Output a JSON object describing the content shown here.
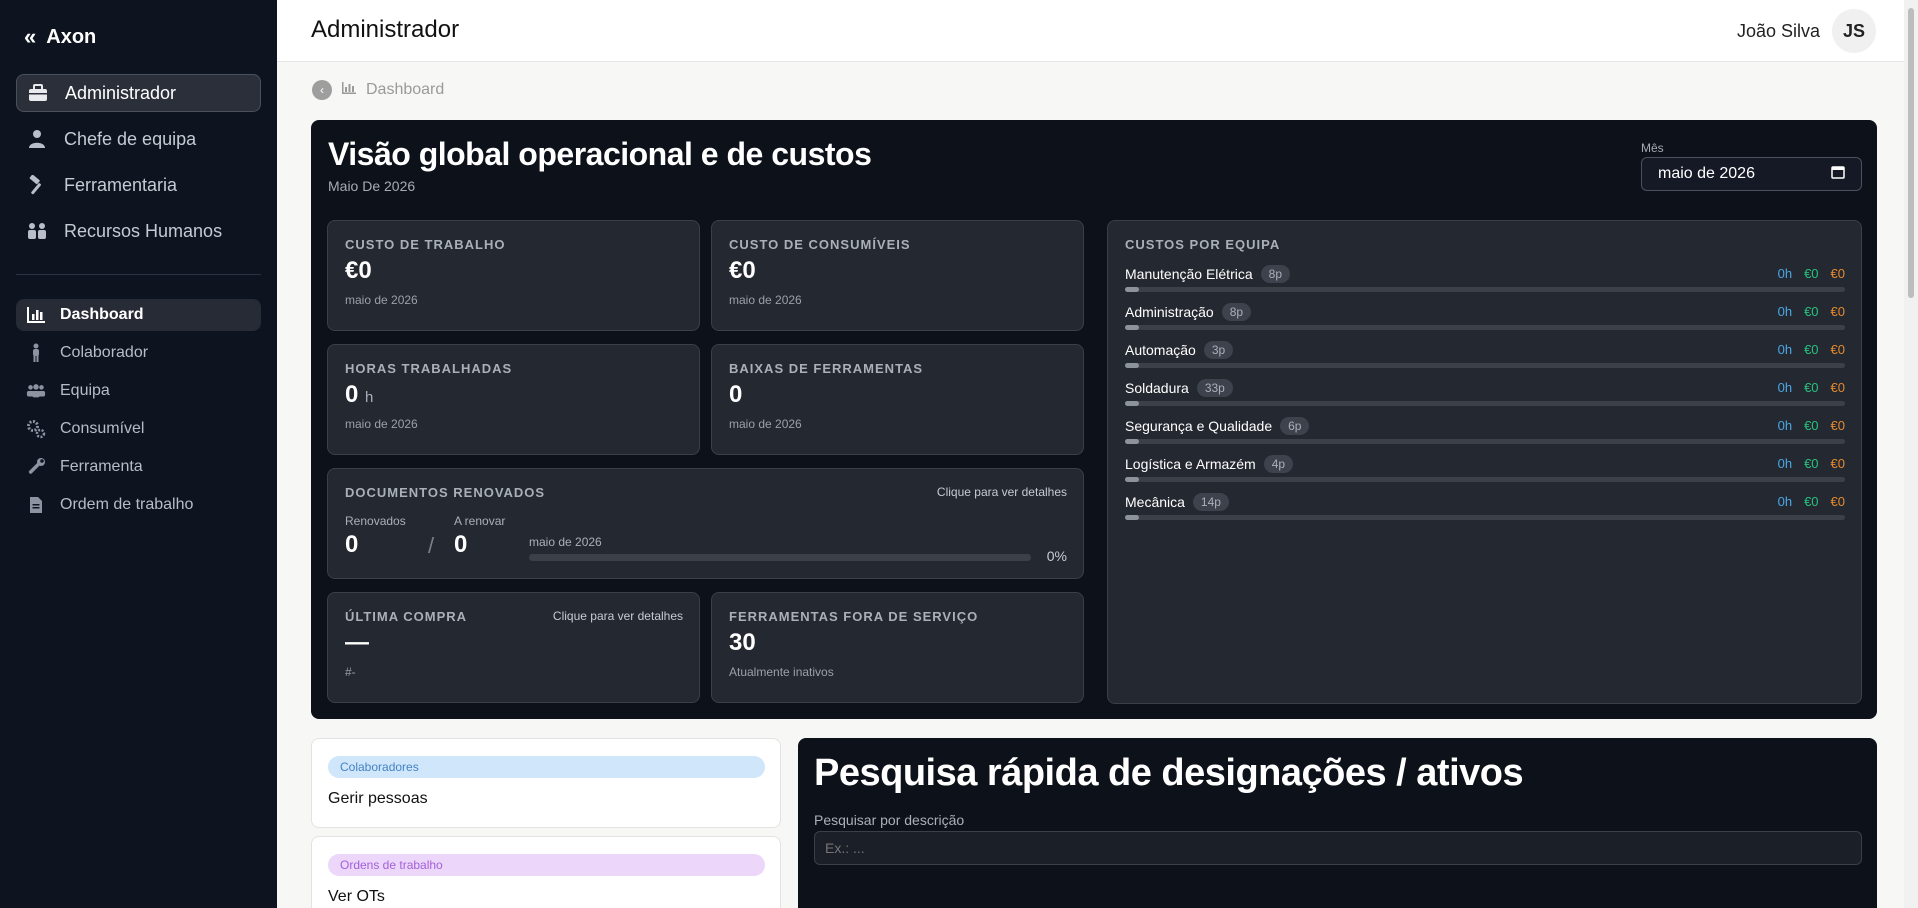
{
  "sidebar": {
    "brand": "Axon",
    "roles": [
      {
        "label": "Administrador",
        "icon": "briefcase-icon",
        "active": true
      },
      {
        "label": "Chefe de equipa",
        "icon": "user-tie-icon"
      },
      {
        "label": "Ferramentaria",
        "icon": "hammer-icon"
      },
      {
        "label": "Recursos Humanos",
        "icon": "people-icon"
      }
    ],
    "nav": [
      {
        "label": "Dashboard",
        "icon": "chart-bar-icon",
        "active": true
      },
      {
        "label": "Colaborador",
        "icon": "person-icon"
      },
      {
        "label": "Equipa",
        "icon": "group-icon"
      },
      {
        "label": "Consumível",
        "icon": "gears-icon"
      },
      {
        "label": "Ferramenta",
        "icon": "wrench-icon"
      },
      {
        "label": "Ordem de trabalho",
        "icon": "document-icon"
      }
    ]
  },
  "header": {
    "title": "Administrador",
    "user_name": "João Silva",
    "user_initials": "JS"
  },
  "breadcrumb": {
    "label": "Dashboard"
  },
  "overview": {
    "title": "Visão global operacional e de custos",
    "subtitle": "Maio De 2026",
    "month_label": "Mês",
    "month_value": "maio de 2026",
    "cards": {
      "labor_cost": {
        "label": "CUSTO DE TRABALHO",
        "value": "€0",
        "sub": "maio de 2026"
      },
      "consumables_cost": {
        "label": "CUSTO DE CONSUMÍVEIS",
        "value": "€0",
        "sub": "maio de 2026"
      },
      "hours_worked": {
        "label": "HORAS TRABALHADAS",
        "value": "0",
        "unit": "h",
        "sub": "maio de 2026"
      },
      "tool_writeoffs": {
        "label": "BAIXAS DE FERRAMENTAS",
        "value": "0",
        "sub": "maio de 2026"
      },
      "documents": {
        "label": "DOCUMENTOS RENOVADOS",
        "link": "Clique para ver detalhes",
        "renewed_label": "Renovados",
        "renewed_value": "0",
        "separator": "/",
        "to_renew_label": "A renovar",
        "to_renew_value": "0",
        "period": "maio de 2026",
        "percent": "0%",
        "progress": 0
      },
      "last_purchase": {
        "label": "ÚLTIMA COMPRA",
        "link": "Clique para ver detalhes",
        "value": "—",
        "sub": "#-"
      },
      "tools_out_of_service": {
        "label": "FERRAMENTAS FORA DE SERVIÇO",
        "value": "30",
        "sub": "Atualmente inativos"
      }
    },
    "teams": {
      "label": "CUSTOS POR EQUIPA",
      "rows": [
        {
          "name": "Manutenção Elétrica",
          "badge": "8p",
          "hours": "0h",
          "cost1": "€0",
          "cost2": "€0",
          "progress": 0.02
        },
        {
          "name": "Administração",
          "badge": "8p",
          "hours": "0h",
          "cost1": "€0",
          "cost2": "€0",
          "progress": 0.02
        },
        {
          "name": "Automação",
          "badge": "3p",
          "hours": "0h",
          "cost1": "€0",
          "cost2": "€0",
          "progress": 0.02
        },
        {
          "name": "Soldadura",
          "badge": "33p",
          "hours": "0h",
          "cost1": "€0",
          "cost2": "€0",
          "progress": 0.02
        },
        {
          "name": "Segurança e Qualidade",
          "badge": "6p",
          "hours": "0h",
          "cost1": "€0",
          "cost2": "€0",
          "progress": 0.02
        },
        {
          "name": "Logística e Armazém",
          "badge": "4p",
          "hours": "0h",
          "cost1": "€0",
          "cost2": "€0",
          "progress": 0.02
        },
        {
          "name": "Mecânica",
          "badge": "14p",
          "hours": "0h",
          "cost1": "€0",
          "cost2": "€0",
          "progress": 0.02
        }
      ]
    }
  },
  "quick_links": [
    {
      "pill": "Colaboradores",
      "text": "Gerir pessoas",
      "color": "blue"
    },
    {
      "pill": "Ordens de trabalho",
      "text": "Ver OTs",
      "color": "purple"
    }
  ],
  "search": {
    "title": "Pesquisa rápida de designações / ativos",
    "label": "Pesquisar por descrição",
    "placeholder": "Ex.: ..."
  },
  "colors": {
    "sidebar_bg": "#0e1320",
    "panel_bg": "#0d1119",
    "hours_color": "#4aa8e6",
    "cost_green": "#27c27f",
    "cost_orange": "#e68a2e"
  }
}
